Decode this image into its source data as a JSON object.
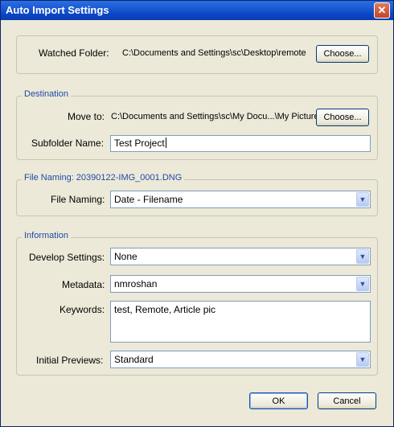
{
  "window": {
    "title": "Auto Import Settings",
    "close_glyph": "✕"
  },
  "watched": {
    "label": "Watched Folder:",
    "path": "C:\\Documents and Settings\\sc\\Desktop\\remote",
    "choose_label": "Choose..."
  },
  "destination": {
    "caption": "Destination",
    "move_label": "Move to:",
    "move_path": "C:\\Documents and Settings\\sc\\My Docu...\\My Pictures",
    "choose_label": "Choose...",
    "subfolder_label": "Subfolder Name:",
    "subfolder_value": "Test Project"
  },
  "file_naming": {
    "caption": "File Naming:  20390122-IMG_0001.DNG",
    "label": "File Naming:",
    "value": "Date - Filename"
  },
  "information": {
    "caption": "Information",
    "develop_label": "Develop Settings:",
    "develop_value": "None",
    "metadata_label": "Metadata:",
    "metadata_value": "nmroshan",
    "keywords_label": "Keywords:",
    "keywords_value": "test, Remote, Article pic",
    "previews_label": "Initial Previews:",
    "previews_value": "Standard"
  },
  "footer": {
    "ok_label": "OK",
    "cancel_label": "Cancel"
  },
  "icons": {
    "dropdown": "chevron-down-icon",
    "close": "close-icon"
  },
  "colors": {
    "titlebar": "#0a46c4",
    "group_caption": "#1f4aa8",
    "dialog_bg": "#ece9d8"
  }
}
